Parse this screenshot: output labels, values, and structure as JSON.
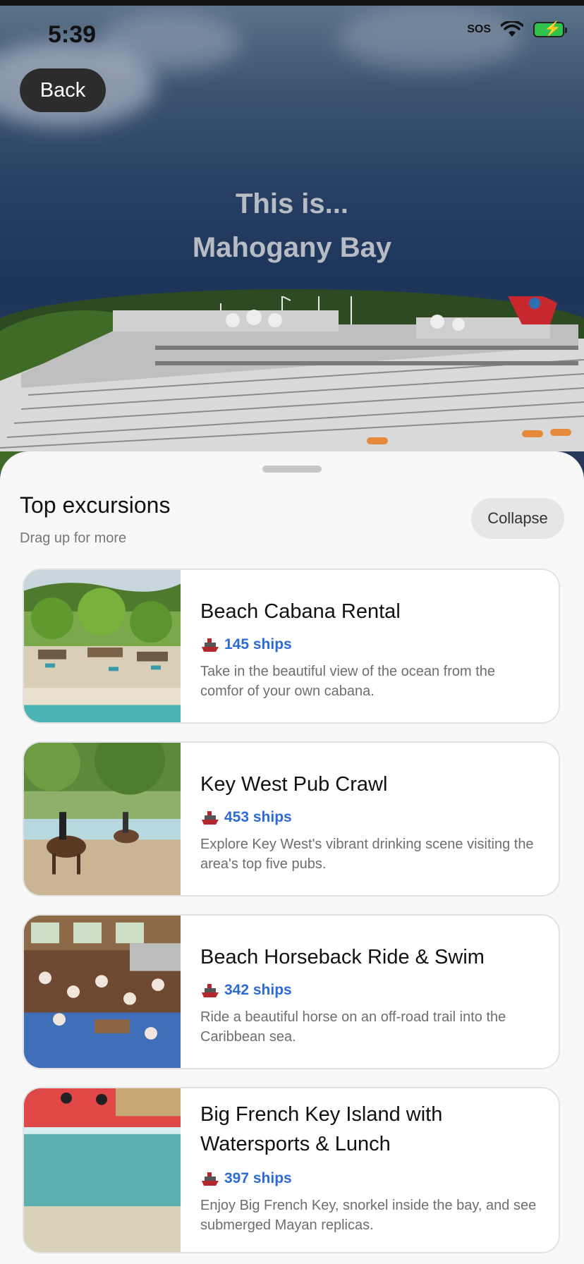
{
  "status": {
    "time": "5:39",
    "sos": "SOS"
  },
  "hero": {
    "title_line1": "This is...",
    "title_line2": "Mahogany Bay",
    "back_label": "Back"
  },
  "sheet": {
    "title": "Top excursions",
    "subtitle": "Drag up for more",
    "collapse_label": "Collapse"
  },
  "excursions": [
    {
      "title": "Beach Cabana Rental",
      "ships": "145 ships",
      "description": "Take in the beautiful view of the ocean from the comfor of your own cabana."
    },
    {
      "title": "Key West Pub Crawl",
      "ships": "453 ships",
      "description": "Explore Key West's vibrant drinking scene visiting the area's top five pubs."
    },
    {
      "title": "Beach Horseback Ride & Swim",
      "ships": "342 ships",
      "description": "Ride a beautiful horse on an off-road trail into the Caribbean sea."
    },
    {
      "title": "Big French Key Island with Watersports & Lunch",
      "ships": "397 ships",
      "description": "Enjoy Big French Key, snorkel inside the bay, and see submerged Mayan replicas."
    }
  ],
  "colors": {
    "link": "#2c6bd6",
    "sheet_bg": "#f8f8f8",
    "battery": "#31c24d"
  },
  "icons": {
    "ship": "ship-icon",
    "wifi": "wifi-icon",
    "battery": "battery-icon"
  }
}
